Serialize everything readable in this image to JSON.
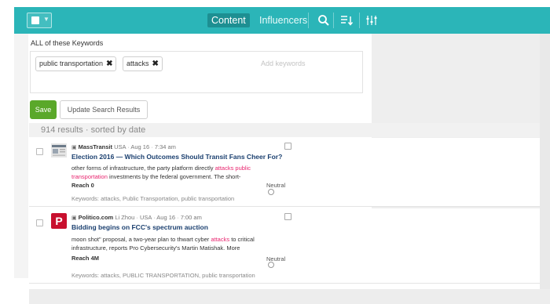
{
  "topbar": {
    "tabs": [
      {
        "label": "Content",
        "active": true
      },
      {
        "label": "Influencers",
        "active": false
      }
    ],
    "icons": [
      "search-icon",
      "sort-icon",
      "filter-sliders-icon"
    ]
  },
  "keywords_section": {
    "title": "ALL of these Keywords",
    "chips": [
      "public transportation",
      "attacks"
    ],
    "placeholder": "Add keywords"
  },
  "actions": {
    "save_label": "Save",
    "update_label": "Update Search Results"
  },
  "results": {
    "summary": "914 results · sorted by date",
    "items": [
      {
        "source": "MassTransit",
        "meta_parts": [
          "USA",
          "Aug 16",
          "7:34 am"
        ],
        "title": "Election 2016 — Which Outcomes Should Transit Fans Cheer For?",
        "snippet_before": "other forms of infrastructure, the party platform directly ",
        "snippet_highlight": "attacks public transportation",
        "snippet_after": " investments by the federal government. The short-",
        "reach": "Reach 0",
        "sentiment": "Neutral",
        "keywords": "Keywords: attacks, Public Transportation, public transportation"
      },
      {
        "source": "Politico.com",
        "author": "Li Zhou",
        "meta_parts": [
          "USA",
          "Aug 16",
          "7:00 am"
        ],
        "title": "Bidding begins on FCC's spectrum auction",
        "snippet_before": "moon shot\" proposal, a two-year plan to thwart cyber ",
        "snippet_highlight": "attacks",
        "snippet_after": " to critical infrastructure, reports Pro Cybersecurity's Martin Matishak. More",
        "reach": "Reach 4M",
        "sentiment": "Neutral",
        "keywords": "Keywords: attacks, PUBLIC TRANSPORTATION, public transportation",
        "logo_letter": "P"
      }
    ]
  },
  "colors": {
    "topbar": "#2bb5b8",
    "active_tab": "#1d8f92",
    "save_button": "#5aa82a",
    "highlight": "#e8246e",
    "title_link": "#1a3f6f"
  }
}
